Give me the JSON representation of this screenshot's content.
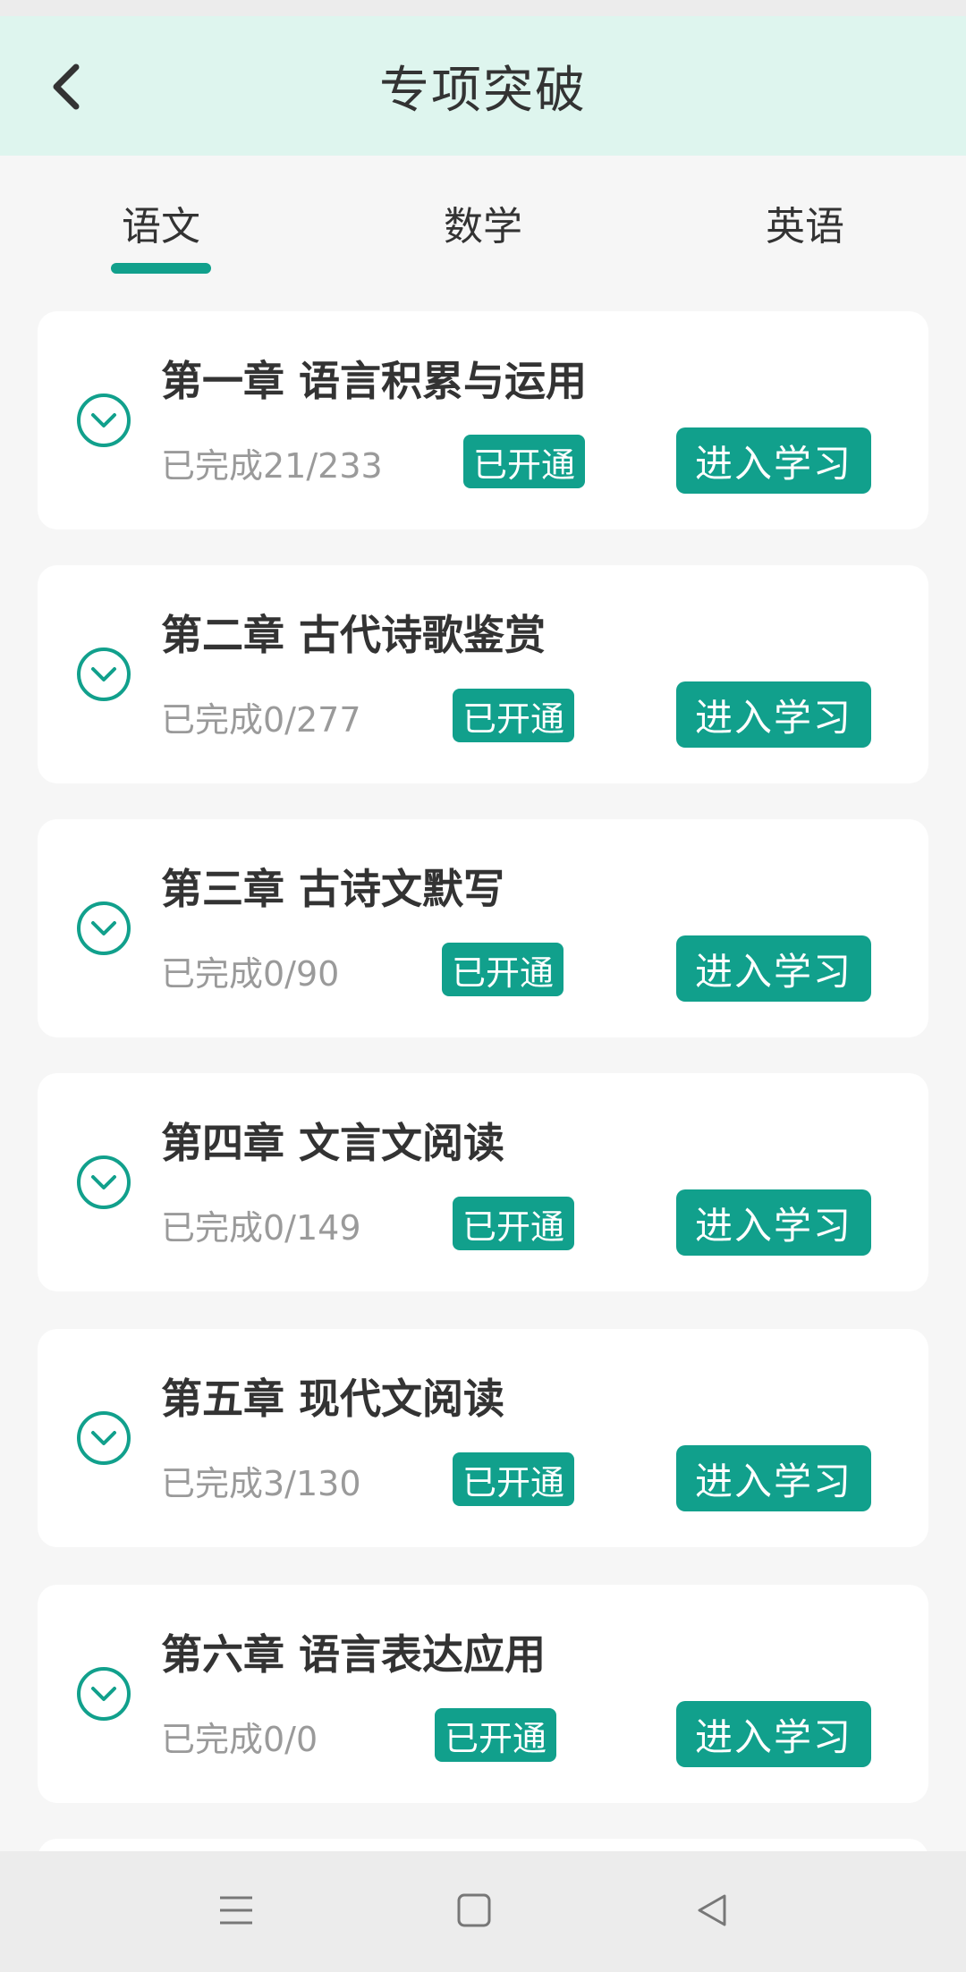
{
  "header": {
    "title": "专项突破",
    "back_icon": "chevron-left-icon"
  },
  "tabs": [
    {
      "label": "语文",
      "selected": true
    },
    {
      "label": "数学",
      "selected": false
    },
    {
      "label": "英语",
      "selected": false
    }
  ],
  "chapters": [
    {
      "title": "第一章 语言积累与运用",
      "progress": "已完成21/233",
      "status": "已开通",
      "action": "进入学习"
    },
    {
      "title": "第二章 古代诗歌鉴赏",
      "progress": "已完成0/277",
      "status": "已开通",
      "action": "进入学习"
    },
    {
      "title": "第三章 古诗文默写",
      "progress": "已完成0/90",
      "status": "已开通",
      "action": "进入学习"
    },
    {
      "title": "第四章 文言文阅读",
      "progress": "已完成0/149",
      "status": "已开通",
      "action": "进入学习"
    },
    {
      "title": "第五章 现代文阅读",
      "progress": "已完成3/130",
      "status": "已开通",
      "action": "进入学习"
    },
    {
      "title": "第六章 语言表达应用",
      "progress": "已完成0/0",
      "status": "已开通",
      "action": "进入学习"
    }
  ],
  "colors": {
    "accent": "#11a08c",
    "header_bg": "#def5ee",
    "page_bg": "#f6f6f6"
  },
  "nav": {
    "menu_icon": "menu-icon",
    "home_icon": "home-square-icon",
    "back_icon": "back-triangle-icon"
  }
}
